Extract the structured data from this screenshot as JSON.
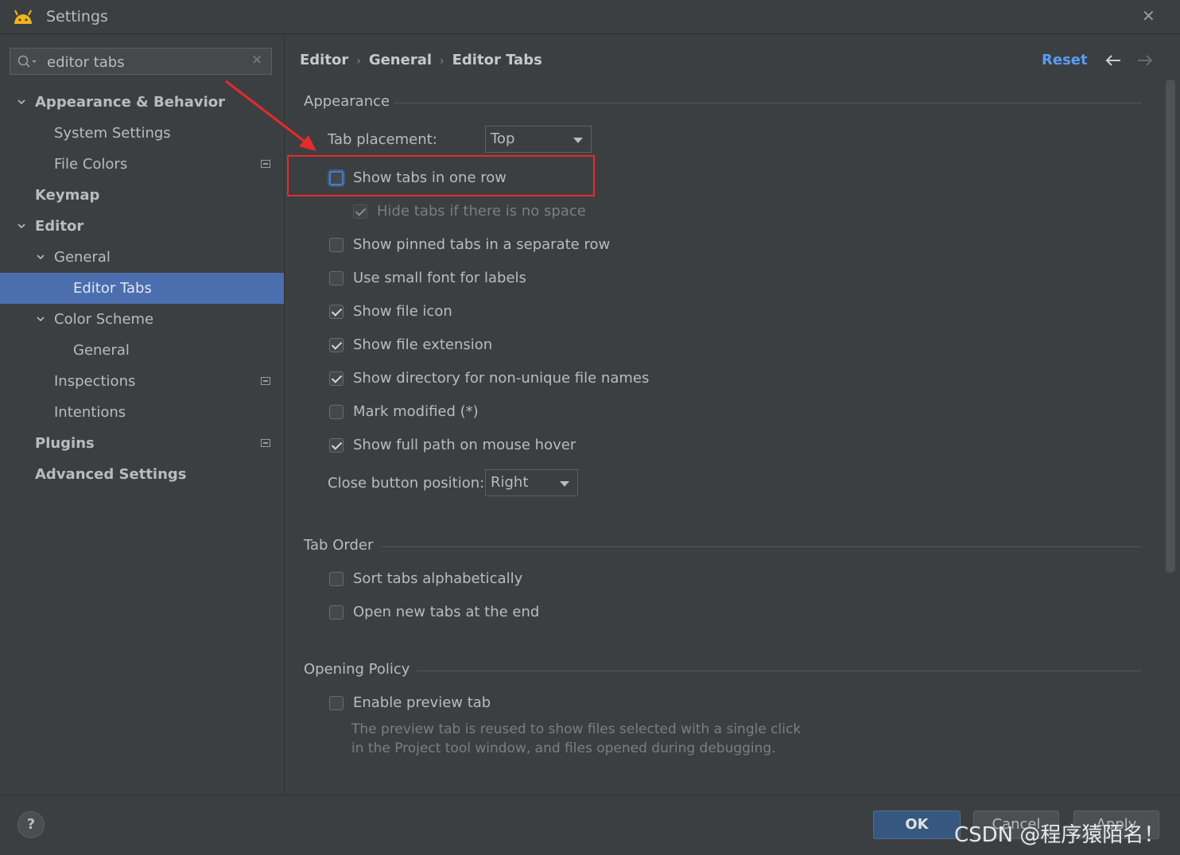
{
  "window": {
    "title": "Settings",
    "close_label": "✕"
  },
  "sidebar": {
    "search": {
      "value": "editor tabs",
      "clear_label": "✕"
    },
    "items": [
      {
        "label": "Appearance & Behavior"
      },
      {
        "label": "System Settings"
      },
      {
        "label": "File Colors"
      },
      {
        "label": "Keymap"
      },
      {
        "label": "Editor"
      },
      {
        "label": "General"
      },
      {
        "label": "Editor Tabs"
      },
      {
        "label": "Color Scheme"
      },
      {
        "label": "General"
      },
      {
        "label": "Inspections"
      },
      {
        "label": "Intentions"
      },
      {
        "label": "Plugins"
      },
      {
        "label": "Advanced Settings"
      }
    ]
  },
  "header": {
    "breadcrumb": [
      "Editor",
      "General",
      "Editor Tabs"
    ],
    "reset_label": "Reset"
  },
  "appearance": {
    "section_title": "Appearance",
    "tab_placement_label": "Tab placement:",
    "tab_placement_value": "Top",
    "show_tabs_one_row": {
      "label": "Show tabs in one row",
      "checked": false
    },
    "hide_tabs_no_space": {
      "label": "Hide tabs if there is no space",
      "checked": true,
      "disabled": true
    },
    "show_pinned_separate": {
      "label": "Show pinned tabs in a separate row",
      "checked": false
    },
    "small_font": {
      "label": "Use small font for labels",
      "checked": false
    },
    "show_file_icon": {
      "label": "Show file icon",
      "checked": true
    },
    "show_file_extension": {
      "label": "Show file extension",
      "checked": true
    },
    "show_directory": {
      "label": "Show directory for non-unique file names",
      "checked": true
    },
    "mark_modified": {
      "label": "Mark modified (*)",
      "checked": false
    },
    "show_full_path": {
      "label": "Show full path on mouse hover",
      "checked": true
    },
    "close_button_label": "Close button position:",
    "close_button_value": "Right"
  },
  "tab_order": {
    "section_title": "Tab Order",
    "sort_alpha": {
      "label": "Sort tabs alphabetically",
      "checked": false
    },
    "open_at_end": {
      "label": "Open new tabs at the end",
      "checked": false
    }
  },
  "opening_policy": {
    "section_title": "Opening Policy",
    "enable_preview": {
      "label": "Enable preview tab",
      "checked": false
    },
    "preview_desc_line1": "The preview tab is reused to show files selected with a single click",
    "preview_desc_line2": "in the Project tool window, and files opened during debugging."
  },
  "footer": {
    "help_label": "?",
    "ok_label": "OK",
    "cancel_label": "Cancel",
    "apply_label": "Apply"
  },
  "watermark": "CSDN @程序猿陌名！",
  "colors": {
    "accent": "#4b6eaf",
    "link": "#589df6",
    "highlight": "#e52b2b",
    "background": "#3c3f41"
  }
}
